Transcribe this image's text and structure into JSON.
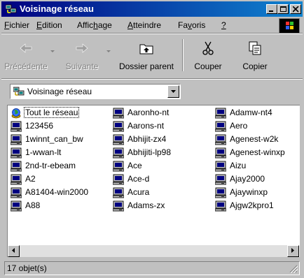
{
  "window": {
    "title": "Voisinage réseau"
  },
  "menu": [
    {
      "pre": "",
      "u": "F",
      "post": "ichier"
    },
    {
      "pre": "",
      "u": "E",
      "post": "dition"
    },
    {
      "pre": "Affic",
      "u": "h",
      "post": "age"
    },
    {
      "pre": "",
      "u": "A",
      "post": "tteindre"
    },
    {
      "pre": "Fa",
      "u": "v",
      "post": "oris"
    },
    {
      "pre": "",
      "u": "?",
      "post": ""
    }
  ],
  "toolbar": {
    "back": "Précédente",
    "forward": "Suivante",
    "up": "Dossier parent",
    "cut": "Couper",
    "copy": "Copier"
  },
  "address": {
    "value": "Voisinage réseau"
  },
  "items": [
    [
      "Tout le réseau",
      "123456",
      "1winnt_can_bw",
      "1-wwan-lt",
      "2nd-tr-ebeam",
      "A2",
      "A81404-win2000",
      "A88"
    ],
    [
      "Aaronho-nt",
      "Aarons-nt",
      "Abhijit-zx4",
      "Abhijiti-lp98",
      "Ace",
      "Ace-d",
      "Acura",
      "Adams-zx"
    ],
    [
      "Adamw-nt4",
      "Aero",
      "Agenest-w2k",
      "Agenest-winxp",
      "Aizu",
      "Ajay2000",
      "Ajaywinxp",
      "Ajgw2kpro1"
    ]
  ],
  "icons": {
    "network": "entire-network-globe-icon",
    "computer": "computer-icon"
  },
  "status": {
    "text": "17 objet(s)"
  }
}
